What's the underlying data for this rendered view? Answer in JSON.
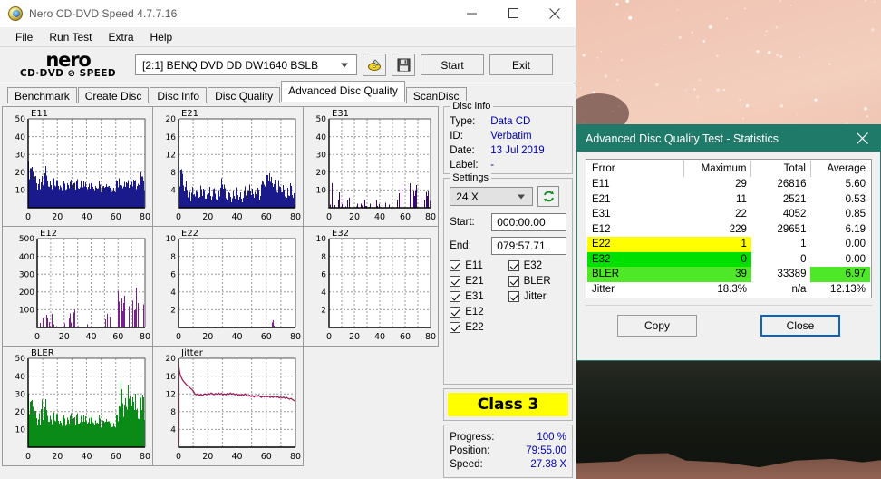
{
  "window": {
    "title": "Nero CD-DVD Speed 4.7.7.16",
    "icon": "disc-icon",
    "minimize": "minimize-icon",
    "maximize": "maximize-icon",
    "close": "close-icon"
  },
  "menubar": {
    "items": [
      "File",
      "Run Test",
      "Extra",
      "Help"
    ]
  },
  "toolbar": {
    "logo_word": "nero",
    "logo_sub": "CD·DVD ⊘ SPEED",
    "drive": "[2:1]   BENQ DVD DD DW1640 BSLB",
    "eject_icon": "eject-disc-icon",
    "save_icon": "floppy-save-icon",
    "start_label": "Start",
    "exit_label": "Exit"
  },
  "tabs": {
    "items": [
      "Benchmark",
      "Create Disc",
      "Disc Info",
      "Disc Quality",
      "Advanced Disc Quality",
      "ScanDisc"
    ],
    "active_index": 4
  },
  "disc_info": {
    "legend": "Disc info",
    "rows": [
      {
        "label": "Type:",
        "value": "Data CD"
      },
      {
        "label": "ID:",
        "value": "Verbatim"
      },
      {
        "label": "Date:",
        "value": "13 Jul 2019"
      },
      {
        "label": "Label:",
        "value": "-"
      }
    ]
  },
  "settings": {
    "legend": "Settings",
    "speed": "24 X",
    "refresh_icon": "refresh-icon",
    "start_label": "Start:",
    "start_value": "000:00.00",
    "end_label": "End:",
    "end_value": "079:57.71",
    "checkboxes": [
      {
        "label": "E11",
        "checked": true
      },
      {
        "label": "E32",
        "checked": true
      },
      {
        "label": "E21",
        "checked": true
      },
      {
        "label": "BLER",
        "checked": true
      },
      {
        "label": "E31",
        "checked": true
      },
      {
        "label": "Jitter",
        "checked": true
      },
      {
        "label": "E12",
        "checked": true
      },
      {
        "label": "",
        "checked": false
      },
      {
        "label": "E22",
        "checked": true
      },
      {
        "label": "",
        "checked": false
      }
    ]
  },
  "class_badge": {
    "text": "Class 3",
    "color": "#ffff00"
  },
  "progress": {
    "rows": [
      {
        "label": "Progress:",
        "value": "100 %"
      },
      {
        "label": "Position:",
        "value": "79:55.00"
      },
      {
        "label": "Speed:",
        "value": "27.38 X"
      }
    ]
  },
  "stats_dialog": {
    "title": "Advanced Disc Quality Test - Statistics",
    "close_icon": "close-icon",
    "headers": [
      "Error",
      "Maximum",
      "Total",
      "Average"
    ],
    "rows": [
      {
        "error": "E11",
        "maximum": "29",
        "total": "26816",
        "average": "5.60",
        "highlight": "none"
      },
      {
        "error": "E21",
        "maximum": "11",
        "total": "2521",
        "average": "0.53",
        "highlight": "none"
      },
      {
        "error": "E31",
        "maximum": "22",
        "total": "4052",
        "average": "0.85",
        "highlight": "none"
      },
      {
        "error": "E12",
        "maximum": "229",
        "total": "29651",
        "average": "6.19",
        "highlight": "none"
      },
      {
        "error": "E22",
        "maximum": "1",
        "total": "1",
        "average": "0.00",
        "highlight": "yellow"
      },
      {
        "error": "E32",
        "maximum": "0",
        "total": "0",
        "average": "0.00",
        "highlight": "green"
      },
      {
        "error": "BLER",
        "maximum": "39",
        "total": "33389",
        "average": "6.97",
        "highlight": "green-split"
      },
      {
        "error": "Jitter",
        "maximum": "18.3%",
        "total": "n/a",
        "average": "12.13%",
        "highlight": "none"
      }
    ],
    "copy_label": "Copy",
    "close_label": "Close"
  },
  "chart_data": [
    {
      "type": "area",
      "name": "E11",
      "title": "E11",
      "color": "#1a1a8c",
      "xlabel": "",
      "ylabel": "",
      "xticks": [
        0,
        20,
        40,
        60,
        80
      ],
      "yticks": [
        10,
        20,
        30,
        40,
        50
      ],
      "xlim": [
        0,
        80
      ],
      "ylim": [
        0,
        50
      ],
      "grid": true,
      "values": [
        26,
        21,
        28,
        24,
        18,
        20,
        14,
        19,
        15,
        22,
        17,
        24,
        27,
        18,
        13,
        16,
        12,
        19,
        14,
        21,
        16,
        11,
        18,
        13,
        20,
        15,
        12,
        17,
        14,
        19,
        10,
        16,
        13,
        20,
        15,
        11,
        18,
        12,
        17,
        14,
        10,
        16,
        12,
        18,
        13,
        9,
        15,
        11,
        17,
        12,
        10,
        14,
        11,
        16,
        12,
        18,
        13,
        10,
        15,
        11,
        17,
        13,
        20,
        15,
        12,
        18,
        14,
        21,
        16,
        12,
        19,
        14,
        22,
        17,
        13,
        20,
        15,
        24,
        18,
        14
      ]
    },
    {
      "type": "area",
      "name": "E21",
      "title": "E21",
      "color": "#1a1a8c",
      "xticks": [
        0,
        20,
        40,
        60,
        80
      ],
      "yticks": [
        4,
        8,
        12,
        16,
        20
      ],
      "xlim": [
        0,
        80
      ],
      "ylim": [
        0,
        20
      ],
      "grid": true,
      "values": [
        5,
        8,
        11,
        6,
        4,
        7,
        3,
        5,
        2,
        6,
        4,
        3,
        5,
        4,
        2,
        6,
        3,
        5,
        2,
        4,
        3,
        5,
        2,
        4,
        6,
        3,
        2,
        5,
        3,
        8,
        4,
        6,
        3,
        2,
        5,
        3,
        1,
        4,
        2,
        5,
        3,
        2,
        4,
        1,
        3,
        5,
        2,
        4,
        6,
        3,
        5,
        2,
        4,
        3,
        6,
        2,
        5,
        8,
        7,
        6,
        8,
        7,
        9,
        7,
        5,
        8,
        6,
        4,
        7,
        5,
        3,
        6,
        4,
        2,
        5,
        3,
        6,
        4,
        2,
        6
      ]
    },
    {
      "type": "area",
      "name": "E31",
      "title": "E31",
      "color": "#3b0a6e",
      "xticks": [
        0,
        20,
        40,
        60,
        80
      ],
      "yticks": [
        10,
        20,
        30,
        40,
        50
      ],
      "xlim": [
        0,
        80
      ],
      "ylim": [
        0,
        50
      ],
      "grid": true,
      "values": [
        0,
        2,
        18,
        4,
        0,
        6,
        0,
        3,
        9,
        0,
        2,
        7,
        0,
        1,
        5,
        0,
        9,
        2,
        0,
        16,
        4,
        0,
        2,
        8,
        0,
        3,
        0,
        11,
        2,
        0,
        5,
        0,
        2,
        9,
        0,
        1,
        0,
        4,
        0,
        2,
        0,
        0,
        1,
        0,
        3,
        0,
        7,
        2,
        11,
        5,
        9,
        3,
        12,
        6,
        2,
        10,
        4,
        14,
        8,
        16,
        21,
        11,
        7,
        13,
        9,
        5,
        10,
        6,
        12,
        8,
        4,
        9,
        5,
        17,
        7,
        3,
        11,
        6,
        9,
        4
      ]
    },
    {
      "type": "area",
      "name": "E12",
      "title": "E12",
      "color": "#7b1f8c",
      "xticks": [
        0,
        20,
        40,
        60,
        80
      ],
      "yticks": [
        100,
        200,
        300,
        400,
        500
      ],
      "xlim": [
        0,
        80
      ],
      "ylim": [
        0,
        500
      ],
      "grid": true,
      "values": [
        0,
        0,
        30,
        200,
        60,
        20,
        100,
        40,
        60,
        10,
        0,
        90,
        20,
        0,
        10,
        0,
        60,
        90,
        30,
        0,
        20,
        0,
        150,
        50,
        70,
        10,
        0,
        120,
        40,
        10,
        0,
        60,
        0,
        10,
        0,
        0,
        0,
        20,
        0,
        0,
        0,
        0,
        0,
        10,
        0,
        0,
        110,
        160,
        60,
        110,
        40,
        100,
        60,
        100,
        30,
        90,
        170,
        130,
        225,
        205,
        150,
        90,
        190,
        80,
        170,
        100,
        60,
        150,
        70,
        190,
        100,
        200,
        60,
        190,
        160,
        120,
        80,
        40,
        140,
        50
      ]
    },
    {
      "type": "area",
      "name": "E22",
      "title": "E22",
      "color": "#7b1f8c",
      "xticks": [
        0,
        20,
        40,
        60,
        80
      ],
      "yticks": [
        2,
        4,
        6,
        8,
        10
      ],
      "xlim": [
        0,
        80
      ],
      "ylim": [
        0,
        10
      ],
      "grid": true,
      "values": [
        0,
        0,
        0,
        0,
        0,
        0,
        0,
        0,
        0,
        0,
        0,
        0,
        0,
        0,
        0,
        0,
        0,
        0,
        0,
        0,
        0,
        0,
        0,
        0,
        0,
        0,
        0,
        0,
        0,
        0,
        0,
        0,
        0,
        0,
        0,
        0,
        0,
        0,
        0,
        0,
        0,
        0,
        0,
        0,
        0,
        0,
        0,
        0,
        0,
        0,
        0,
        0,
        0,
        0,
        0,
        0,
        0,
        0,
        0,
        0,
        0,
        0,
        0,
        0,
        1,
        0,
        0,
        0,
        0,
        0,
        0,
        0,
        0,
        0,
        0,
        0,
        0,
        0,
        0,
        0
      ]
    },
    {
      "type": "area",
      "name": "E32",
      "title": "E32",
      "color": "#7b1f8c",
      "xticks": [
        0,
        20,
        40,
        60,
        80
      ],
      "yticks": [
        2,
        4,
        6,
        8,
        10
      ],
      "xlim": [
        0,
        80
      ],
      "ylim": [
        0,
        10
      ],
      "grid": true,
      "values": [
        0,
        0,
        0,
        0,
        0,
        0,
        0,
        0,
        0,
        0,
        0,
        0,
        0,
        0,
        0,
        0,
        0,
        0,
        0,
        0,
        0,
        0,
        0,
        0,
        0,
        0,
        0,
        0,
        0,
        0,
        0,
        0,
        0,
        0,
        0,
        0,
        0,
        0,
        0,
        0,
        0,
        0,
        0,
        0,
        0,
        0,
        0,
        0,
        0,
        0,
        0,
        0,
        0,
        0,
        0,
        0,
        0,
        0,
        0,
        0,
        0,
        0,
        0,
        0,
        0,
        0,
        0,
        0,
        0,
        0,
        0,
        0,
        0,
        0,
        0,
        0,
        0,
        0,
        0,
        0
      ]
    },
    {
      "type": "area",
      "name": "BLER",
      "title": "BLER",
      "color": "#0a8a17",
      "xticks": [
        0,
        20,
        40,
        60,
        80
      ],
      "yticks": [
        10,
        20,
        30,
        40,
        50
      ],
      "xlim": [
        0,
        80
      ],
      "ylim": [
        0,
        50
      ],
      "grid": true,
      "values": [
        30,
        24,
        33,
        27,
        21,
        23,
        17,
        22,
        18,
        35,
        20,
        28,
        31,
        21,
        16,
        19,
        15,
        22,
        17,
        25,
        19,
        14,
        21,
        16,
        24,
        18,
        15,
        20,
        17,
        23,
        13,
        19,
        16,
        24,
        18,
        14,
        21,
        15,
        20,
        17,
        13,
        19,
        15,
        21,
        16,
        12,
        18,
        14,
        20,
        15,
        13,
        17,
        14,
        19,
        15,
        21,
        16,
        13,
        18,
        14,
        20,
        16,
        29,
        39,
        31,
        22,
        34,
        27,
        39,
        30,
        25,
        33,
        28,
        36,
        24,
        20,
        30,
        26,
        35,
        22
      ]
    },
    {
      "type": "line",
      "name": "Jitter",
      "title": "Jitter",
      "color": "#9b1050",
      "xticks": [
        0,
        20,
        40,
        60,
        80
      ],
      "yticks": [
        4,
        8,
        12,
        16,
        20
      ],
      "xlim": [
        0,
        80
      ],
      "ylim": [
        0,
        20
      ],
      "grid": true,
      "values": [
        18.5,
        16.5,
        15.6,
        15.0,
        14.6,
        14.2,
        13.9,
        13.6,
        13.3,
        13.0,
        12.6,
        12.0,
        11.8,
        12.0,
        11.7,
        11.9,
        11.6,
        11.9,
        12.0,
        11.8,
        12.1,
        11.9,
        12.2,
        12.0,
        11.8,
        12.1,
        11.9,
        12.2,
        11.9,
        12.1,
        11.8,
        12.0,
        11.8,
        12.1,
        11.9,
        12.2,
        11.9,
        12.1,
        11.8,
        12.0,
        11.7,
        11.9,
        11.6,
        11.9,
        11.7,
        12.0,
        11.7,
        11.5,
        11.7,
        11.4,
        11.6,
        11.3,
        11.6,
        11.4,
        11.7,
        11.4,
        11.2,
        11.5,
        11.3,
        11.6,
        11.3,
        11.5,
        11.2,
        11.4,
        11.2,
        11.5,
        11.2,
        11.4,
        11.1,
        11.3,
        11.1,
        11.3,
        11.0,
        11.2,
        11.0,
        10.8,
        11.0,
        10.7,
        10.5,
        10.4
      ]
    }
  ]
}
